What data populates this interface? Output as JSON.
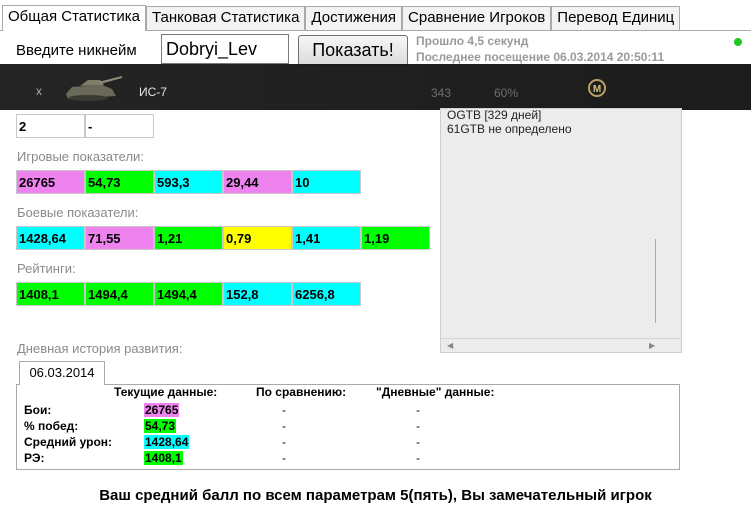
{
  "tabs": [
    "Общая Статистика",
    "Танковая Статистика",
    "Достижения",
    "Сравнение Игроков",
    "Перевод Единиц"
  ],
  "nickname": {
    "label": "Введите никнейм",
    "value": "Dobryi_Lev",
    "button": "Показать!"
  },
  "meta": {
    "load_time": "Прошло 4,5 секунд",
    "last_visit": "Последнее посещение 06.03.2014 20:50:11"
  },
  "overlay": {
    "close": "x",
    "tank_name": "ИС-7",
    "number": "343",
    "percent": "60%",
    "medal": "M"
  },
  "top_row": [
    "2",
    "-"
  ],
  "game_stats": {
    "label": "Игровые показатели:",
    "values": [
      "26765",
      "54,73",
      "593,3",
      "29,44",
      "10"
    ]
  },
  "battle_stats": {
    "label": "Боевые показатели:",
    "values": [
      "1428,64",
      "71,55",
      "1,21",
      "0,79",
      "1,41",
      "1,19"
    ]
  },
  "ratings": {
    "label": "Рейтинги:",
    "values": [
      "1408,1",
      "1494,4",
      "1494,4",
      "152,8",
      "6256,8"
    ]
  },
  "right_panel": {
    "lines": [
      "OGTB [329 дней]",
      "61GTB не определено"
    ]
  },
  "history": {
    "label": "Дневная история развития:",
    "date_tab": "06.03.2014",
    "headers": [
      "Текущие данные:",
      "По сравнению:",
      "\"Дневные\" данные:"
    ],
    "rows": [
      {
        "label": "Бои:",
        "current": "26765",
        "compare": "-",
        "daily": "-"
      },
      {
        "label": "% побед:",
        "current": "54,73",
        "compare": "-",
        "daily": "-"
      },
      {
        "label": "Средний урон:",
        "current": "1428,64",
        "compare": "-",
        "daily": "-"
      },
      {
        "label": "РЭ:",
        "current": "1408,1",
        "compare": "-",
        "daily": "-"
      }
    ]
  },
  "footer": "Ваш средний балл по всем параметрам 5(пять), Вы замечательный игрок",
  "colors": {
    "pink": "#ee82ee",
    "green": "#00ff00",
    "cyan": "#00ffff",
    "yellow": "#ffff00",
    "status": "#1ec81e"
  }
}
